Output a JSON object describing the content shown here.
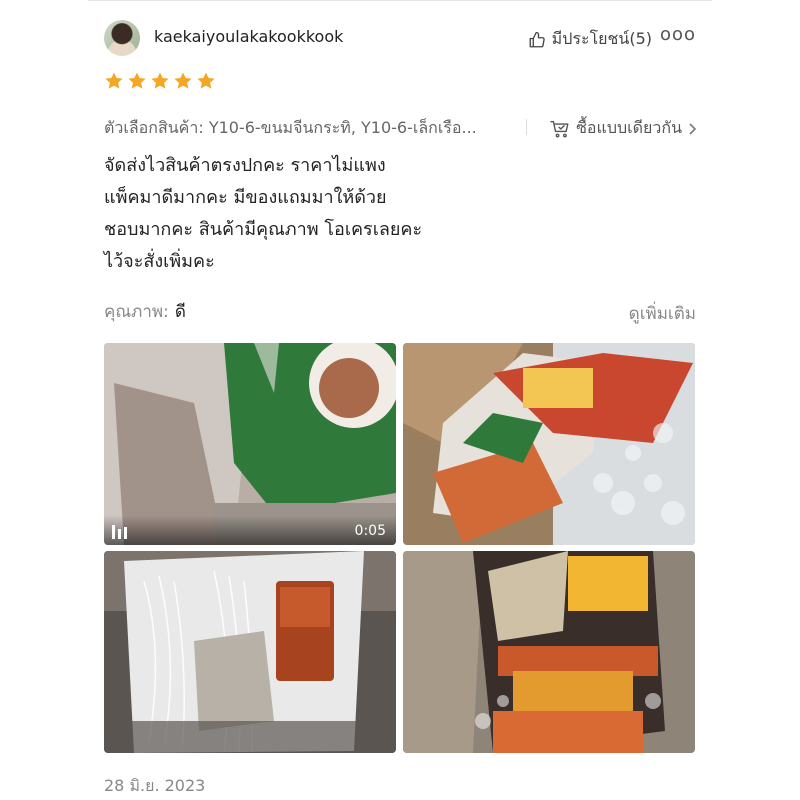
{
  "reviewer": {
    "username": "kaekaiyoulakakookkook",
    "avatar_icon": "avatar-photo"
  },
  "helpful": {
    "label": "มีประโยชน์(5)",
    "icon": "thumbs-up-icon"
  },
  "more_menu": {
    "label": "ooo",
    "icon": "more-icon"
  },
  "rating": {
    "stars": 5,
    "max": 5,
    "color": "#f5a623"
  },
  "variation": {
    "text": "ตัวเลือกสินค้า: Y10-6-ขนมจีนกระทิ, Y10-6-เล็กเรือ...",
    "buy_same_label": "ซื้อแบบเดียวกัน",
    "cart_icon": "cart-icon",
    "chevron_icon": "chevron-right-icon"
  },
  "review_lines": [
    "จัดส่งไวสินค้าตรงปกคะ ราคาไม่แพง",
    "แพ็คมาดีมากคะ มีของแถมมาให้ด้วย",
    "ชอบมากคะ สินค้ามีคุณภาพ โอเครเลยคะ",
    "ไว้จะสั่งเพิ่มคะ"
  ],
  "quality": {
    "label": "คุณภาพ:",
    "value": "ดี"
  },
  "see_more": "ดูเพิ่มเติม",
  "media": {
    "video_duration": "0:05"
  },
  "date": "28 มิ.ย. 2023"
}
